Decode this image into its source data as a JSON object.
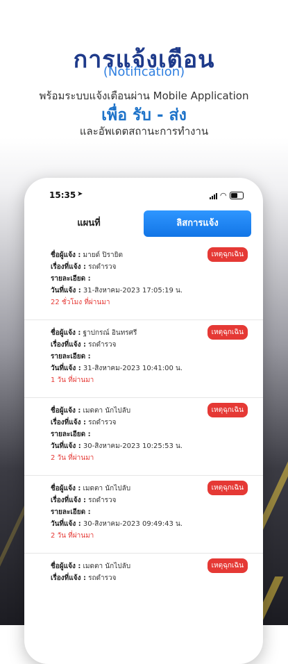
{
  "header": {
    "title": "การแจ้งเตือน",
    "subtitle": "(Notification)",
    "description": "พร้อมระบบแจ้งเตือนผ่าน Mobile Application",
    "highlight": "เพื่อ รับ - ส่ง",
    "description2": "และอัพเดตสถานะการทำงาน"
  },
  "status_bar": {
    "time": "15:35",
    "location_icon": "location-arrow-icon"
  },
  "tabs": {
    "map": "แผนที่",
    "list": "ลิสการแจ้ง"
  },
  "labels": {
    "reporter": "ชื่อผู้แจ้ง :",
    "subject": "เรื่องที่แจ้ง :",
    "detail": "รายละเอียด :",
    "date": "วันที่แจ้ง :"
  },
  "colors": {
    "accent": "#1275e6",
    "badge": "#e53935",
    "title": "#1e3a8a"
  },
  "notifications": [
    {
      "reporter": "มายด์ ปิรายิต",
      "subject": "รถดำรวจ",
      "date": "31-สิงหาคม-2023 17:05:19 น.",
      "ago": "22 ชั่วโมง ที่ผ่านมา",
      "badge": "เหตุฉุกเฉิน"
    },
    {
      "reporter": "ฐาปกรณ์ อินทรศรี",
      "subject": "รถดำรวจ",
      "date": "31-สิงหาคม-2023 10:41:00 น.",
      "ago": "1 วัน ที่ผ่านมา",
      "badge": "เหตุฉุกเฉิน"
    },
    {
      "reporter": "เมดตา นักไปลับ",
      "subject": "รถดำรวจ",
      "date": "30-สิงหาคม-2023 10:25:53 น.",
      "ago": "2 วัน ที่ผ่านมา",
      "badge": "เหตุฉุกเฉิน"
    },
    {
      "reporter": "เมดตา นักไปลับ",
      "subject": "รถดำรวจ",
      "date": "30-สิงหาคม-2023 09:49:43 น.",
      "ago": "2 วัน ที่ผ่านมา",
      "badge": "เหตุฉุกเฉิน"
    },
    {
      "reporter": "เมดตา นักไปลับ",
      "subject": "รถดำรวจ",
      "date": "",
      "ago": "",
      "badge": "เหตุฉุกเฉิน"
    }
  ]
}
